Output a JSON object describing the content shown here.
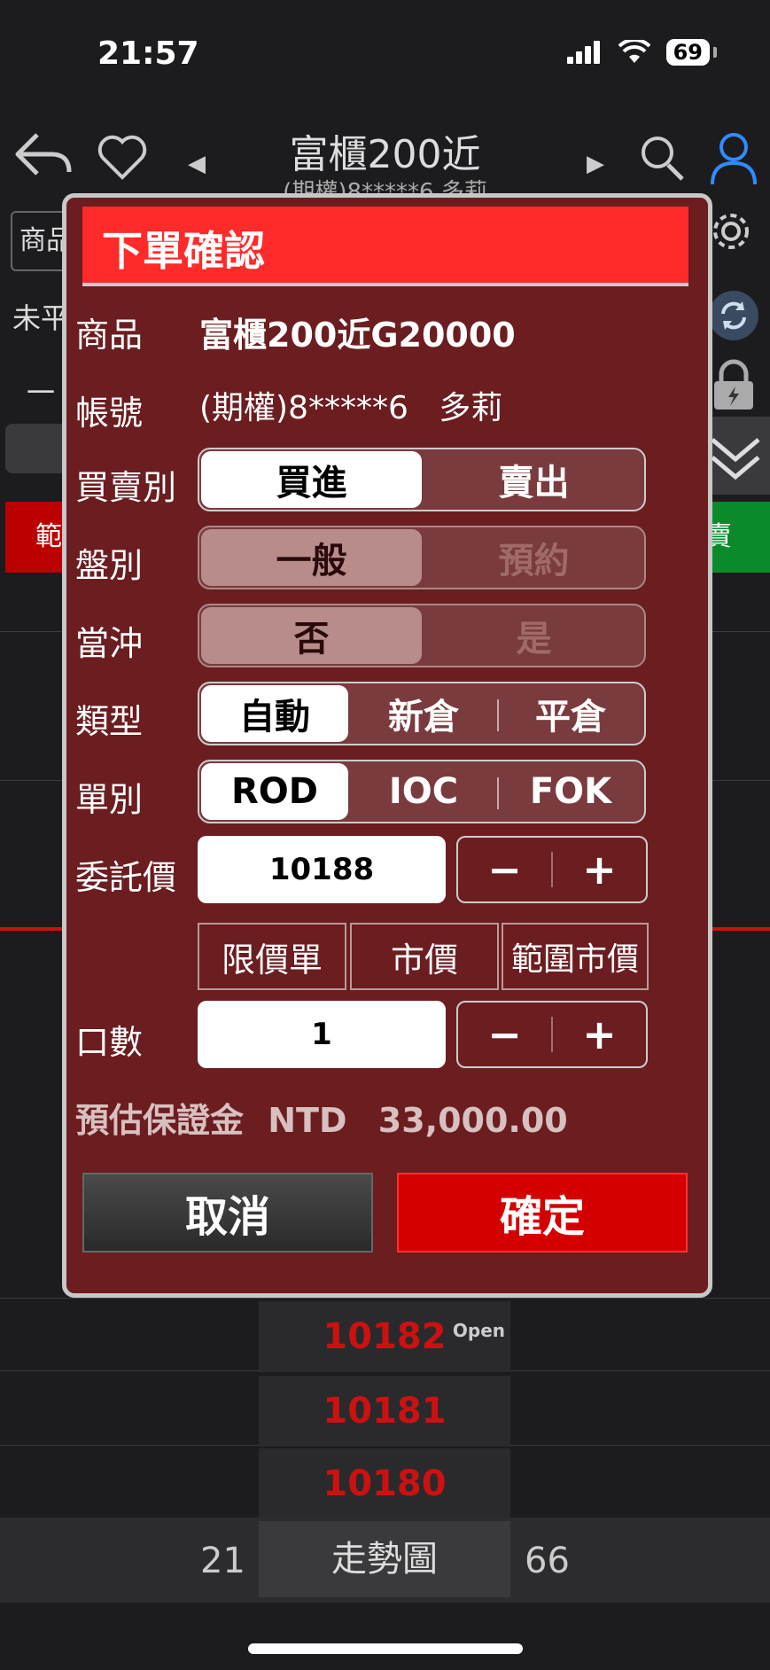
{
  "status": {
    "time": "21:57",
    "battery": "69"
  },
  "header": {
    "title": "富櫃200近",
    "subtitle": "(期權)8*****6  多莉"
  },
  "background": {
    "left_box": "商品",
    "left_label": "未平",
    "left_char": "一",
    "red_tab": "範",
    "green_tab": "賣",
    "prices": [
      "10182",
      "10181",
      "10180"
    ],
    "open_label": "Open",
    "footer_left": "21",
    "footer_button": "走勢圖",
    "footer_right": "66"
  },
  "dialog": {
    "title": "下單確認",
    "product_label": "商品",
    "product_value": "富櫃200近G20000",
    "account_label": "帳號",
    "account_value": "(期權)8*****6   多莉",
    "side_label": "買賣別",
    "side_options": [
      "買進",
      "賣出"
    ],
    "session_label": "盤別",
    "session_options": [
      "一般",
      "預約"
    ],
    "daytrade_label": "當沖",
    "daytrade_options": [
      "否",
      "是"
    ],
    "type_label": "類型",
    "type_options": [
      "自動",
      "新倉",
      "平倉"
    ],
    "order_label": "單別",
    "order_options": [
      "ROD",
      "IOC",
      "FOK"
    ],
    "price_label": "委託價",
    "price_value": "10188",
    "minus": "−",
    "plus": "+",
    "price_types": [
      "限價單",
      "市價",
      "範圍市價"
    ],
    "qty_label": "口數",
    "qty_value": "1",
    "margin_label": "預估保證金",
    "margin_currency": "NTD",
    "margin_value": "33,000.00",
    "cancel": "取消",
    "confirm": "確定"
  },
  "colors": {
    "dialog_bg": "#6b1d20",
    "header_red": "#ff2a2a",
    "confirm_red": "#d40000",
    "price_red": "#cc1111",
    "link_blue": "#2f8cff"
  }
}
